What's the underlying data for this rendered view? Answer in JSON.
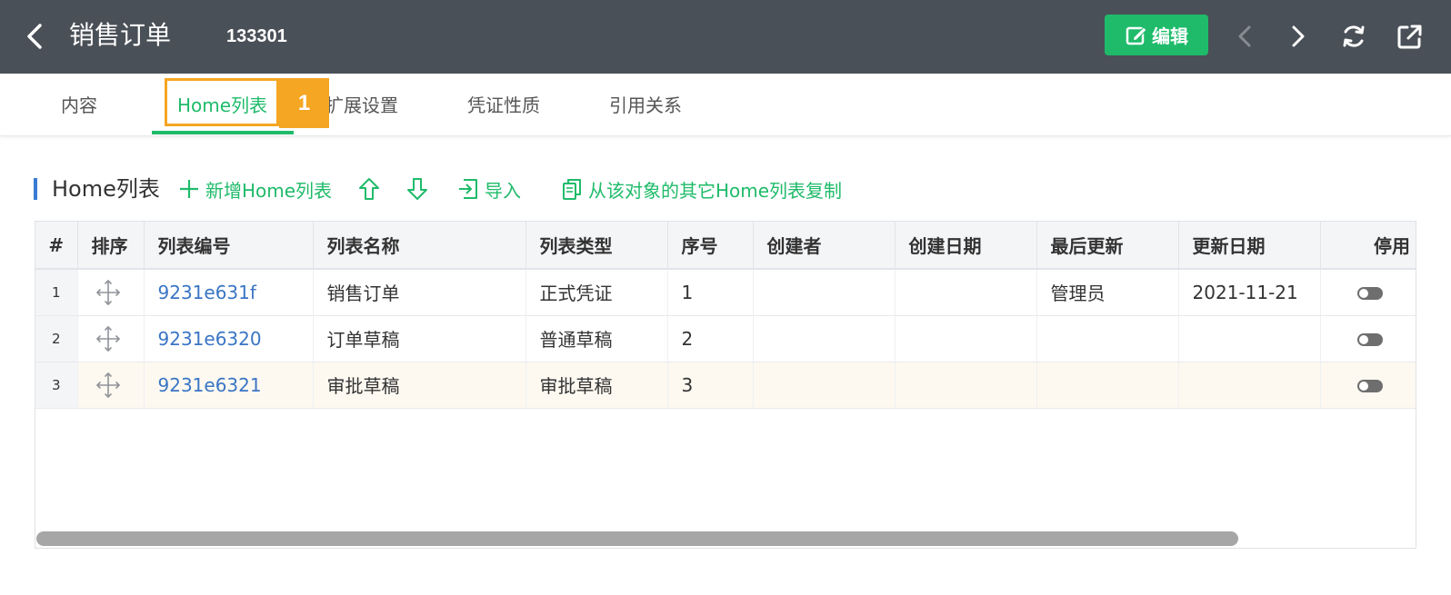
{
  "header": {
    "title": "销售订单",
    "doc_id": "133301",
    "edit_label": "编辑",
    "background": "#4a5057",
    "accent": "#1fbb6a"
  },
  "tabs": [
    {
      "label": "内容"
    },
    {
      "label": "Home列表",
      "active": true
    },
    {
      "label": "扩展设置"
    },
    {
      "label": "凭证性质"
    },
    {
      "label": "引用关系"
    }
  ],
  "callout": {
    "number": "1",
    "color": "#f5a623"
  },
  "toolbar": {
    "section_title": "Home列表",
    "add_label": "新增Home列表",
    "import_label": "导入",
    "copy_label": "从该对象的其它Home列表复制"
  },
  "table": {
    "columns": [
      "#",
      "排序",
      "列表编号",
      "列表名称",
      "列表类型",
      "序号",
      "创建者",
      "创建日期",
      "最后更新",
      "更新日期",
      "停用"
    ],
    "rows": [
      {
        "num": "1",
        "code": "9231e631f",
        "name": "销售订单",
        "type": "正式凭证",
        "seq": "1",
        "creator": "",
        "created": "",
        "updater": "管理员",
        "updated": "2021-11-21"
      },
      {
        "num": "2",
        "code": "9231e6320",
        "name": "订单草稿",
        "type": "普通草稿",
        "seq": "2",
        "creator": "",
        "created": "",
        "updater": "",
        "updated": ""
      },
      {
        "num": "3",
        "code": "9231e6321",
        "name": "审批草稿",
        "type": "审批草稿",
        "seq": "3",
        "creator": "",
        "created": "",
        "updater": "",
        "updated": ""
      }
    ]
  }
}
